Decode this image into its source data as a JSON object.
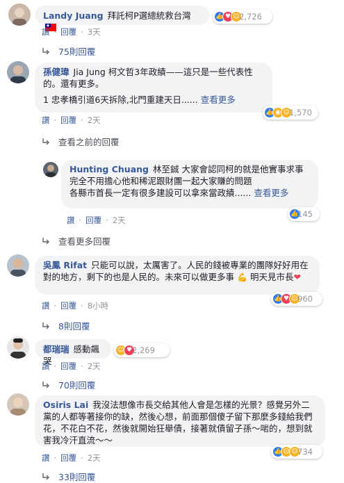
{
  "ui": {
    "read_label": "讚",
    "reply_label": "回覆",
    "see_previous": "查看之前的回覆",
    "see_more_replies": "查看更多回覆"
  },
  "comments": [
    {
      "author": "Landy Juang",
      "text": "拜託柯P選總統救台灣",
      "reactions": [
        "like",
        "love",
        "haha"
      ],
      "reaction_count": "2,726",
      "time": "3天",
      "replies_label": "75則回覆"
    },
    {
      "author": "孫健瑋",
      "text": "Jia Jung 柯文哲3年政績——這只是一些代表性的。還有更多。",
      "line2": "1 忠孝橋引道6天拆除,北門重建天日......",
      "see_more": "查看更多",
      "reactions": [
        "like",
        "wow",
        "haha"
      ],
      "reaction_count": "1,570",
      "time": "2天"
    },
    {
      "author": "Hunting Chuang",
      "text": "林至鋮 大家會認同柯的就是他實事求事",
      "line2": "完全不用擔心他和稀泥跟財團一起大家賺的問題",
      "line3": "各縣市首長一定有很多建設可以拿來當政績......",
      "see_more": "查看更多",
      "reactions": [
        "like"
      ],
      "reaction_count": "145",
      "time": "2天"
    },
    {
      "author": "吳鳳 Rifat",
      "text": "只能可以說，太厲害了。人民的錢被專業的團隊好好用在對的地方，剩下的也是人民的。未來可以做更多事",
      "line_end": "明天見市長",
      "reactions": [
        "like",
        "love",
        "haha"
      ],
      "reaction_count": "960",
      "time": "8小時",
      "replies_label": "8則回覆"
    },
    {
      "author": "都瑞瑞",
      "text": "感動飆哭",
      "reactions": [
        "haha",
        "love"
      ],
      "reaction_count": "2,269",
      "time": "2天",
      "replies_label": "70則回覆"
    },
    {
      "author": "Osiris Lai",
      "text": "我沒法想像市長交給其他人會是怎樣的光景？感覺另外二黨的人都等著接你的缺，然後心想，前面那個傻子留下那麼多錢給我們花，不花白不花，然後就開始狂舉債，接著就債留子孫～啱的，想到就害我冷汗直流～～",
      "reactions": [
        "like",
        "sad",
        "haha"
      ],
      "reaction_count": "734",
      "time": "2天",
      "replies_label": "33則回覆"
    }
  ],
  "colors": {
    "link": "#385898",
    "meta": "#90949c",
    "bubble": "#f2f3f5",
    "like": "#2f7cf6",
    "love": "#f33e58",
    "haha": "#f7b125"
  }
}
